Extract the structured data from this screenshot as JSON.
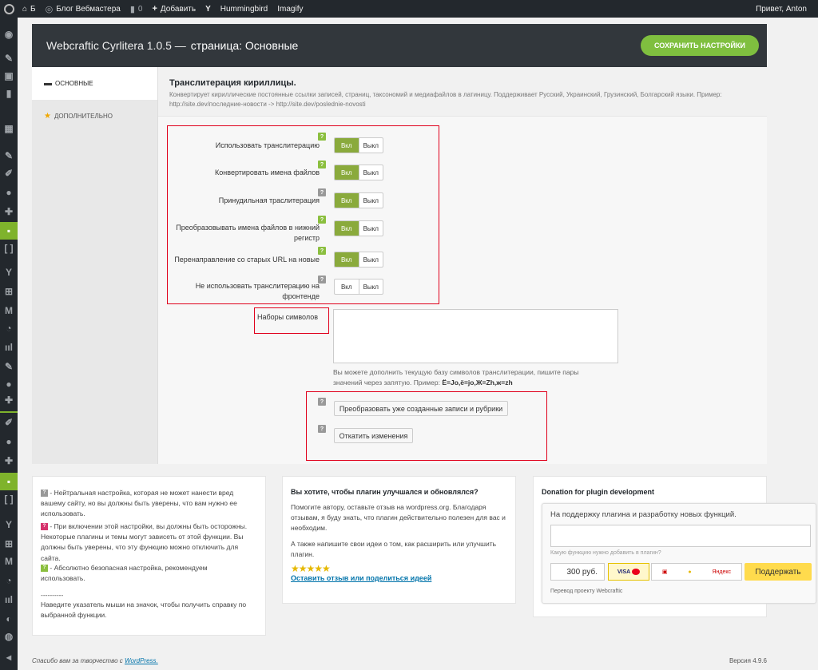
{
  "adminbar": {
    "site_letter": "Б",
    "site_name": "Блог Вебмастера",
    "comments_count": "0",
    "add_new": "Добавить",
    "hummingbird": "Hummingbird",
    "imagify": "Imagify",
    "greeting": "Привет, Anton"
  },
  "header": {
    "title": "Webcraftic Cyrlitera 1.0.5 —",
    "subtitle": "страница: Основные",
    "save_label": "СОХРАНИТЬ НАСТРОЙКИ"
  },
  "tabs": [
    {
      "label": "ОСНОВНЫЕ",
      "icon": "flag-icon"
    },
    {
      "label": "ДОПОЛНИТЕЛЬНО",
      "icon": "star-icon"
    }
  ],
  "section": {
    "title": "Транслитерация кириллицы.",
    "description": "Конвертирует кириллические постоянные ссылки записей, страниц, таксономий и медиафайлов в латиницу. Поддерживает Русский, Украинский, Грузинский, Болгарский языки. Пример: http://site.dev/последние-новости -> http://site.dev/poslednie-novosti"
  },
  "options": [
    {
      "label": "Использовать транслитерацию",
      "help": "green",
      "on": true
    },
    {
      "label": "Конвертировать имена файлов",
      "help": "green",
      "on": true
    },
    {
      "label": "Принудильная траслитерация",
      "help": "grey",
      "on": true
    },
    {
      "label": "Преобразовывать имена файлов в нижний регистр",
      "help": "green",
      "on": true
    },
    {
      "label": "Перенаправление со старых URL на новые",
      "help": "green",
      "on": true
    },
    {
      "label": "Не использовать транслитерацию на фронтенде",
      "help": "grey",
      "on": false
    }
  ],
  "toggle": {
    "on": "Вкл",
    "off": "Выкл"
  },
  "charset": {
    "label": "Наборы символов",
    "value": "",
    "hint": "Вы можете дополнить текущую базу символов транслитерации, пишите пары значений через запятую. Пример:",
    "example": "Ё=Jo,ё=jo,Ж=Zh,ж=zh"
  },
  "actions": {
    "convert": "Преобразовать уже созданные записи и рубрики",
    "rollback": "Откатить изменения"
  },
  "legend": {
    "grey": "- Нейтральная настройка, которая не может нанести вред вашему сайту, но вы должны быть уверены, что вам нужно ее использовать.",
    "red": "- При включении этой настройки, вы должны быть осторожны. Некоторые плагины и темы могут зависеть от этой функции. Вы должны быть уверены, что эту функцию можно отключить для сайта.",
    "green": "- Абсолютно безопасная настройка, рекомендуем использовать.",
    "separator": "----------",
    "tip": "Наведите указатель мыши на значок, чтобы получить справку по выбранной функции."
  },
  "feedback": {
    "title": "Вы хотите, чтобы плагин улучшался и обновлялся?",
    "p1": "Помогите автору, оставьте отзыв на wordpress.org. Благодаря отзывам, я буду знать, что плагин действительно полезен для вас и необходим.",
    "p2": "А также напишите свои идеи о том, как расширить или улучшить плагин.",
    "stars": "★★★★★",
    "link": "Оставить отзыв или поделиться идеей"
  },
  "donation": {
    "title": "Donation for plugin development",
    "widget_title": "На поддержку плагина и разработку новых функций.",
    "input_placeholder": "",
    "hint": "Какую функцию нужно добавить в плагин?",
    "amount": "300 руб.",
    "pay_label": "Поддержать",
    "visa": "VISA",
    "yandex": "Яндекс",
    "footer": "Перевод проекту Webcraftic"
  },
  "footer": {
    "thanks": "Спасибо вам за творчество с",
    "wp": "WordPress.",
    "version": "Версия 4.9.6"
  },
  "colors": {
    "accent": "#7fb32c",
    "toggle_on": "#8aaa3c",
    "highlight_box": "#e0001b"
  }
}
